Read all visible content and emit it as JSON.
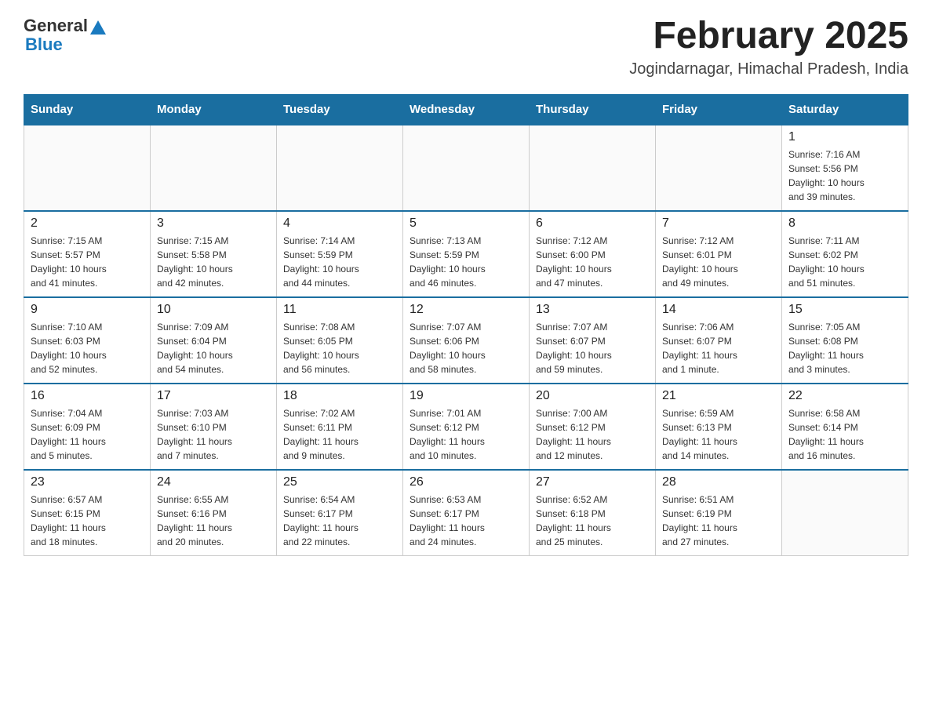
{
  "header": {
    "logo_general": "General",
    "logo_blue": "Blue",
    "title": "February 2025",
    "subtitle": "Jogindarnagar, Himachal Pradesh, India"
  },
  "days_of_week": [
    "Sunday",
    "Monday",
    "Tuesday",
    "Wednesday",
    "Thursday",
    "Friday",
    "Saturday"
  ],
  "weeks": [
    [
      {
        "day": "",
        "info": ""
      },
      {
        "day": "",
        "info": ""
      },
      {
        "day": "",
        "info": ""
      },
      {
        "day": "",
        "info": ""
      },
      {
        "day": "",
        "info": ""
      },
      {
        "day": "",
        "info": ""
      },
      {
        "day": "1",
        "info": "Sunrise: 7:16 AM\nSunset: 5:56 PM\nDaylight: 10 hours\nand 39 minutes."
      }
    ],
    [
      {
        "day": "2",
        "info": "Sunrise: 7:15 AM\nSunset: 5:57 PM\nDaylight: 10 hours\nand 41 minutes."
      },
      {
        "day": "3",
        "info": "Sunrise: 7:15 AM\nSunset: 5:58 PM\nDaylight: 10 hours\nand 42 minutes."
      },
      {
        "day": "4",
        "info": "Sunrise: 7:14 AM\nSunset: 5:59 PM\nDaylight: 10 hours\nand 44 minutes."
      },
      {
        "day": "5",
        "info": "Sunrise: 7:13 AM\nSunset: 5:59 PM\nDaylight: 10 hours\nand 46 minutes."
      },
      {
        "day": "6",
        "info": "Sunrise: 7:12 AM\nSunset: 6:00 PM\nDaylight: 10 hours\nand 47 minutes."
      },
      {
        "day": "7",
        "info": "Sunrise: 7:12 AM\nSunset: 6:01 PM\nDaylight: 10 hours\nand 49 minutes."
      },
      {
        "day": "8",
        "info": "Sunrise: 7:11 AM\nSunset: 6:02 PM\nDaylight: 10 hours\nand 51 minutes."
      }
    ],
    [
      {
        "day": "9",
        "info": "Sunrise: 7:10 AM\nSunset: 6:03 PM\nDaylight: 10 hours\nand 52 minutes."
      },
      {
        "day": "10",
        "info": "Sunrise: 7:09 AM\nSunset: 6:04 PM\nDaylight: 10 hours\nand 54 minutes."
      },
      {
        "day": "11",
        "info": "Sunrise: 7:08 AM\nSunset: 6:05 PM\nDaylight: 10 hours\nand 56 minutes."
      },
      {
        "day": "12",
        "info": "Sunrise: 7:07 AM\nSunset: 6:06 PM\nDaylight: 10 hours\nand 58 minutes."
      },
      {
        "day": "13",
        "info": "Sunrise: 7:07 AM\nSunset: 6:07 PM\nDaylight: 10 hours\nand 59 minutes."
      },
      {
        "day": "14",
        "info": "Sunrise: 7:06 AM\nSunset: 6:07 PM\nDaylight: 11 hours\nand 1 minute."
      },
      {
        "day": "15",
        "info": "Sunrise: 7:05 AM\nSunset: 6:08 PM\nDaylight: 11 hours\nand 3 minutes."
      }
    ],
    [
      {
        "day": "16",
        "info": "Sunrise: 7:04 AM\nSunset: 6:09 PM\nDaylight: 11 hours\nand 5 minutes."
      },
      {
        "day": "17",
        "info": "Sunrise: 7:03 AM\nSunset: 6:10 PM\nDaylight: 11 hours\nand 7 minutes."
      },
      {
        "day": "18",
        "info": "Sunrise: 7:02 AM\nSunset: 6:11 PM\nDaylight: 11 hours\nand 9 minutes."
      },
      {
        "day": "19",
        "info": "Sunrise: 7:01 AM\nSunset: 6:12 PM\nDaylight: 11 hours\nand 10 minutes."
      },
      {
        "day": "20",
        "info": "Sunrise: 7:00 AM\nSunset: 6:12 PM\nDaylight: 11 hours\nand 12 minutes."
      },
      {
        "day": "21",
        "info": "Sunrise: 6:59 AM\nSunset: 6:13 PM\nDaylight: 11 hours\nand 14 minutes."
      },
      {
        "day": "22",
        "info": "Sunrise: 6:58 AM\nSunset: 6:14 PM\nDaylight: 11 hours\nand 16 minutes."
      }
    ],
    [
      {
        "day": "23",
        "info": "Sunrise: 6:57 AM\nSunset: 6:15 PM\nDaylight: 11 hours\nand 18 minutes."
      },
      {
        "day": "24",
        "info": "Sunrise: 6:55 AM\nSunset: 6:16 PM\nDaylight: 11 hours\nand 20 minutes."
      },
      {
        "day": "25",
        "info": "Sunrise: 6:54 AM\nSunset: 6:17 PM\nDaylight: 11 hours\nand 22 minutes."
      },
      {
        "day": "26",
        "info": "Sunrise: 6:53 AM\nSunset: 6:17 PM\nDaylight: 11 hours\nand 24 minutes."
      },
      {
        "day": "27",
        "info": "Sunrise: 6:52 AM\nSunset: 6:18 PM\nDaylight: 11 hours\nand 25 minutes."
      },
      {
        "day": "28",
        "info": "Sunrise: 6:51 AM\nSunset: 6:19 PM\nDaylight: 11 hours\nand 27 minutes."
      },
      {
        "day": "",
        "info": ""
      }
    ]
  ]
}
